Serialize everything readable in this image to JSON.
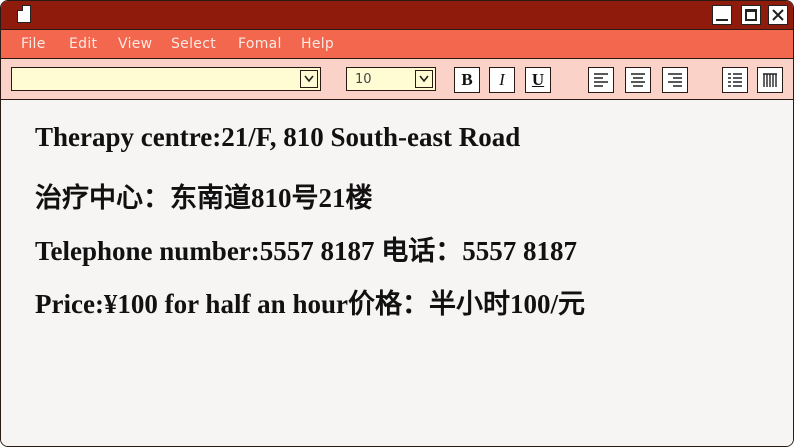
{
  "window": {
    "controls": {
      "minimize": "minimize-icon",
      "maximize": "maximize-icon",
      "close": "close-icon"
    },
    "title_icon": "document-icon",
    "colors": {
      "titlebar": "#8e1b0c",
      "menubar": "#f2674e",
      "toolbar": "#fbd2c7",
      "content": "#f7f5f3",
      "input": "#fffbd2"
    }
  },
  "menu": {
    "file": "File",
    "edit": "Edit",
    "view": "View",
    "select": "Select",
    "format": "Fomal",
    "help": "Help"
  },
  "toolbar": {
    "font_family": {
      "value": ""
    },
    "font_size": {
      "value": "10"
    },
    "bold": "B",
    "italic": "I",
    "underline": "U",
    "align_left": "align-left-icon",
    "align_center": "align-center-icon",
    "align_right": "align-right-icon",
    "list": "bullet-list-icon",
    "columns": "columns-icon"
  },
  "document": {
    "lines": [
      "Therapy centre:21/F, 810 South-east Road",
      "治疗中心：东南道810号21楼",
      "Telephone number:5557 8187 电话：5557 8187",
      "Price:¥100 for half an hour价格：半小时100/元"
    ]
  }
}
